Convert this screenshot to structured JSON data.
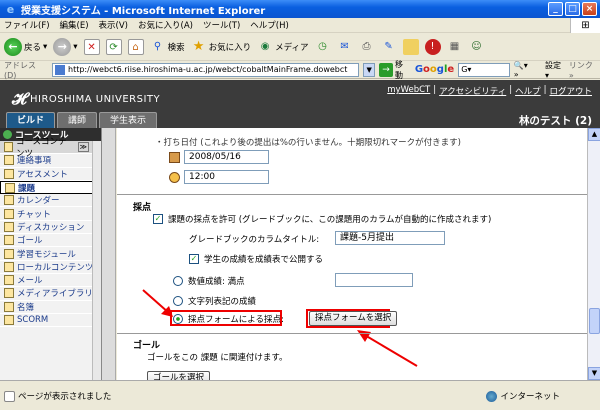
{
  "window": {
    "title": "授業支援システム - Microsoft Internet Explorer"
  },
  "menu": [
    "ファイル(F)",
    "編集(E)",
    "表示(V)",
    "お気に入り(A)",
    "ツール(T)",
    "ヘルプ(H)"
  ],
  "toolbar": {
    "back": "戻る",
    "search": "検索",
    "favorites": "お気に入り",
    "media": "メディア"
  },
  "address": {
    "label": "アドレス(D)",
    "url": "http://webct6.riise.hiroshima-u.ac.jp/webct/cobaltMainFrame.dowebct",
    "go": "移動",
    "google_input": "G▾",
    "settings": "設定▾",
    "links": "リンク »"
  },
  "header": {
    "university": "HIROSHIMA UNIVERSITY",
    "links": [
      "myWebCT",
      "アクセシビリティ",
      "ヘルプ",
      "ログアウト"
    ],
    "course_title": "林のテスト (2)",
    "tabs": [
      "ビルド",
      "講師",
      "学生表示"
    ]
  },
  "sidebar": {
    "heading": "コースツール",
    "items": [
      {
        "label": "コースコンテンツ",
        "type": "sub"
      },
      {
        "label": "連絡事項"
      },
      {
        "label": "アセスメント"
      },
      {
        "label": "課題",
        "selected": true
      },
      {
        "label": "カレンダー"
      },
      {
        "label": "チャット"
      },
      {
        "label": "ディスカッション"
      },
      {
        "label": "ゴール"
      },
      {
        "label": "学習モジュール"
      },
      {
        "label": "ローカルコンテンツ"
      },
      {
        "label": "メール"
      },
      {
        "label": "メディアライブラリ"
      },
      {
        "label": "名簿"
      },
      {
        "label": "SCORM"
      }
    ]
  },
  "main": {
    "due_text": "・打ち日付 (これより後の提出は%の行いません。十期限切れマークが付きます)",
    "date": "2008/05/16",
    "time": "12:00",
    "grading": {
      "title": "採点",
      "allow_label": "課題の採点を許可 (グレードブックに、この課題用のカラムが自動的に作成されます)",
      "column_label": "グレードブックのカラムタイトル:",
      "column_value": "課題-5月提出",
      "publish_label": "学生の成績を成績表で公開する",
      "option_numeric": "数値成績: 満点",
      "option_text": "文字列表記の成績",
      "option_form": "採点フォームによる採点:",
      "select_form_button": "採点フォームを選択"
    },
    "goal": {
      "title": "ゴール",
      "desc": "ゴールをこの 課題 に関連付けます。",
      "button": "ゴールを選択"
    }
  },
  "status": {
    "left": "ページが表示されました",
    "right": "インターネット"
  }
}
